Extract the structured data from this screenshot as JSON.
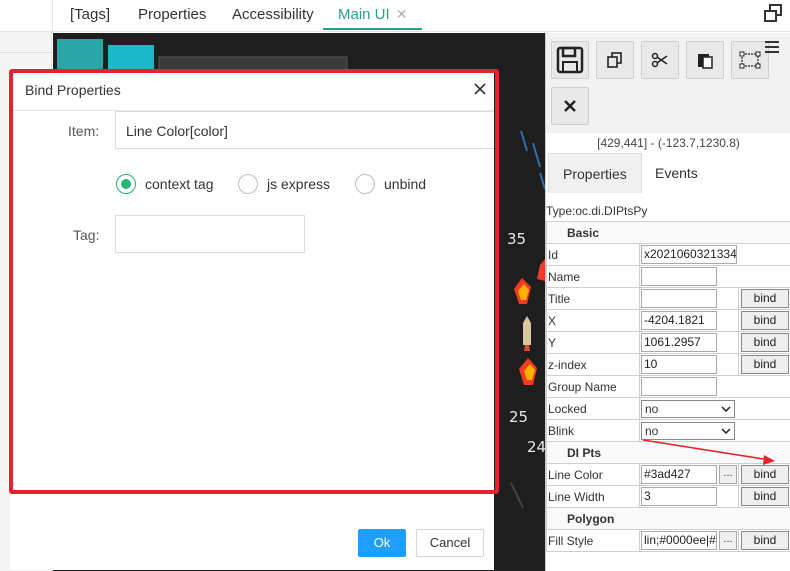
{
  "tabs": {
    "tags": "[Tags]",
    "properties": "Properties",
    "accessibility": "Accessibility",
    "main_ui": "Main UI",
    "close_glyph": "✕"
  },
  "canvas": {
    "gauge_numbers": [
      "35",
      "25",
      "24"
    ]
  },
  "panel": {
    "coords": "[429,441] - (-123.7,1230.8)",
    "tab_properties": "Properties",
    "tab_events": "Events",
    "type_line": "Type:oc.di.DIPtsPy",
    "sections": {
      "basic": "Basic",
      "di_pts": "DI Pts",
      "polygon": "Polygon"
    },
    "rows": {
      "id": {
        "label": "Id",
        "value": "x2021060321334"
      },
      "name": {
        "label": "Name",
        "value": ""
      },
      "title": {
        "label": "Title",
        "value": ""
      },
      "x": {
        "label": "X",
        "value": "-4204.1821"
      },
      "y": {
        "label": "Y",
        "value": "1061.2957"
      },
      "zindex": {
        "label": "z-index",
        "value": "10"
      },
      "group_name": {
        "label": "Group Name",
        "value": ""
      },
      "locked": {
        "label": "Locked",
        "value": "no"
      },
      "blink": {
        "label": "Blink",
        "value": "no"
      },
      "line_color": {
        "label": "Line Color",
        "value": "#3ad427"
      },
      "line_width": {
        "label": "Line Width",
        "value": "3"
      },
      "fill_style": {
        "label": "Fill Style",
        "value": "lin;#0000ee|#"
      }
    },
    "bind_label": "bind",
    "dots_label": "..."
  },
  "modal": {
    "title": "Bind Properties",
    "item_label": "Item:",
    "item_value": "Line Color[color]",
    "radio_context": "context tag",
    "radio_js": "js express",
    "radio_unbind": "unbind",
    "selected_radio": "context tag",
    "tag_label": "Tag:",
    "tag_value": "",
    "ok": "Ok",
    "cancel": "Cancel"
  },
  "colors": {
    "accent": "#2a9d8f",
    "highlight_border": "#e3232f",
    "ok_button": "#1e9fff",
    "radio_selected": "#22b573",
    "canvas_bg": "#1e1e1e"
  }
}
